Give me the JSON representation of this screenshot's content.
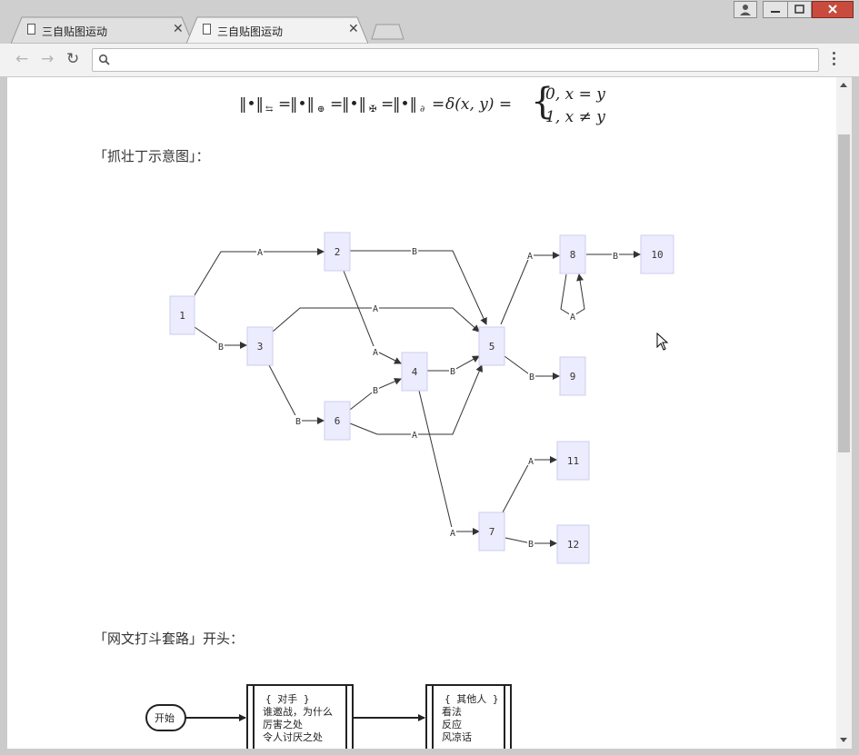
{
  "browser": {
    "tabs": [
      {
        "title": "三自贴图运动",
        "active": false
      },
      {
        "title": "三自贴图运动",
        "active": true
      }
    ],
    "tab_close_glyph": "✕",
    "nav": {
      "back": "←",
      "forward": "→",
      "reload": "↻"
    },
    "address": {
      "value": "",
      "placeholder": ""
    }
  },
  "page": {
    "formula": {
      "left": "‖•‖",
      "subs": [
        "⇆",
        "⊕",
        "✠",
        "∂"
      ],
      "eq": "=",
      "delta": "δ(x, y) =",
      "case1": "0, x = y",
      "case2": "1, x ≠ y"
    },
    "heading1": "「抓壮丁示意图」：",
    "heading2": "「网文打斗套路」开头："
  },
  "graph": {
    "nodes": [
      {
        "id": "1",
        "label": "1"
      },
      {
        "id": "2",
        "label": "2"
      },
      {
        "id": "3",
        "label": "3"
      },
      {
        "id": "4",
        "label": "4"
      },
      {
        "id": "5",
        "label": "5"
      },
      {
        "id": "6",
        "label": "6"
      },
      {
        "id": "7",
        "label": "7"
      },
      {
        "id": "8",
        "label": "8"
      },
      {
        "id": "9",
        "label": "9"
      },
      {
        "id": "10",
        "label": "10"
      },
      {
        "id": "11",
        "label": "11"
      },
      {
        "id": "12",
        "label": "12"
      }
    ],
    "edges": [
      {
        "from": "1",
        "to": "2",
        "label": "A"
      },
      {
        "from": "1",
        "to": "3",
        "label": "B"
      },
      {
        "from": "2",
        "to": "5",
        "label": "B"
      },
      {
        "from": "2",
        "to": "4",
        "label": "A"
      },
      {
        "from": "3",
        "to": "5",
        "label": "A"
      },
      {
        "from": "3",
        "to": "6",
        "label": "B"
      },
      {
        "from": "6",
        "to": "4",
        "label": "B"
      },
      {
        "from": "6",
        "to": "5",
        "label": "A"
      },
      {
        "from": "4",
        "to": "5",
        "label": "B"
      },
      {
        "from": "4",
        "to": "7",
        "label": "A"
      },
      {
        "from": "5",
        "to": "8",
        "label": "A"
      },
      {
        "from": "5",
        "to": "9",
        "label": "B"
      },
      {
        "from": "8",
        "to": "10",
        "label": "B"
      },
      {
        "from": "8",
        "to": "8",
        "label": "A"
      },
      {
        "from": "7",
        "to": "11",
        "label": "A"
      },
      {
        "from": "7",
        "to": "12",
        "label": "B"
      }
    ]
  },
  "flowchart": {
    "start": "开始",
    "box1": [
      "{ 对手 }",
      "谁邀战，为什么",
      "厉害之处",
      "令人讨厌之处"
    ],
    "box2": [
      "{ 其他人 }",
      "看法",
      "反应",
      "风凉话"
    ]
  },
  "colors": {
    "node_fill": "#ececff",
    "node_stroke": "#ccccee",
    "edge": "#333333"
  }
}
